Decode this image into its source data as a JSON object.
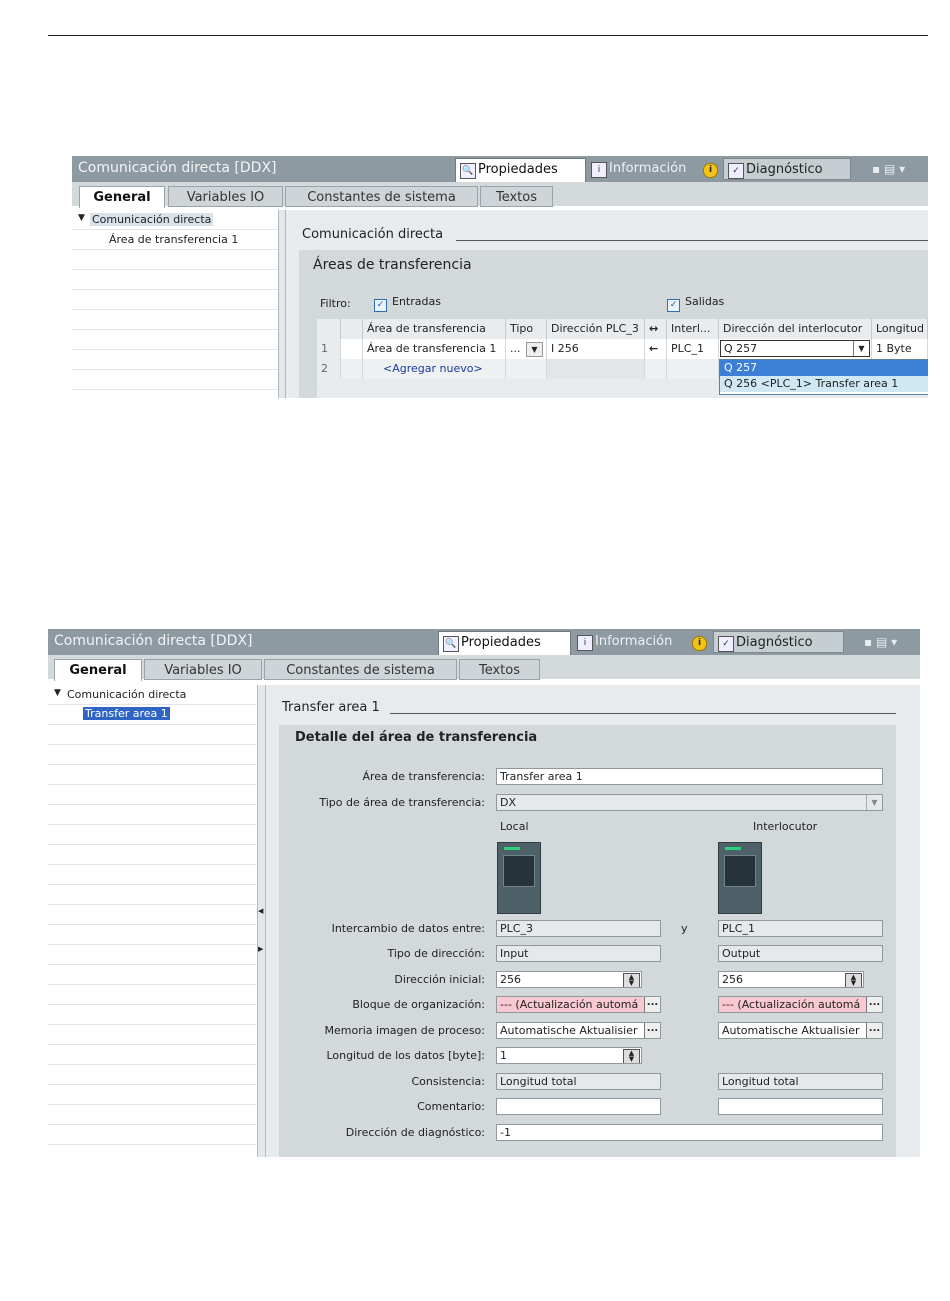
{
  "window": {
    "title": "Comunicación directa [DDX]",
    "inspector_tabs": [
      "Propiedades",
      "Información",
      "Diagnóstico"
    ],
    "main_tabs": [
      "General",
      "Variables IO",
      "Constantes de sistema",
      "Textos"
    ]
  },
  "panel1": {
    "tree_root": "Comunicación directa",
    "tree_child": "Área de transferencia 1",
    "section_title": "Comunicación directa",
    "group_title": "Áreas de transferencia",
    "filter_label": "Filtro:",
    "filter_inputs": "Entradas",
    "filter_outputs": "Salidas",
    "columns": [
      "Área de transferencia",
      "Tipo",
      "Dirección PLC_3",
      "↔",
      "Interl...",
      "Dirección del interlocutor",
      "Longitud"
    ],
    "rows": [
      {
        "num": "1",
        "area": "Área de transferencia 1",
        "tipo": "...",
        "dir_local": "I 256",
        "arrow": "←",
        "interl": "PLC_1",
        "dir_interl": "Q 257",
        "longitud": "1 Byte"
      },
      {
        "num": "2",
        "area": "<Agregar nuevo>",
        "tipo": "",
        "dir_local": "",
        "arrow": "",
        "interl": "",
        "dir_interl": "",
        "longitud": ""
      }
    ],
    "dropdown_options": [
      "Q 257",
      "Q 256 <PLC_1> Transfer area 1"
    ]
  },
  "panel2": {
    "tree_root": "Comunicación directa",
    "tree_child": "Transfer area 1",
    "section_title": "Transfer area 1",
    "group_title": "Detalle del área de transferencia",
    "labels": {
      "area": "Área de transferencia:",
      "tipo_area": "Tipo de área de transferencia:",
      "intercambio": "Intercambio de datos entre:",
      "tipo_dir": "Tipo de dirección:",
      "dir_inicial": "Dirección inicial:",
      "bloque": "Bloque de organización:",
      "memoria": "Memoria imagen de proceso:",
      "longitud": "Longitud de los datos [byte]:",
      "consistencia": "Consistencia:",
      "comentario": "Comentario:",
      "diagnostico": "Dirección de diagnóstico:"
    },
    "col_local": "Local",
    "col_interlocutor": "Interlocutor",
    "conj_y": "y",
    "values": {
      "area": "Transfer area 1",
      "tipo_area": "DX",
      "local_plc": "PLC_3",
      "remote_plc": "PLC_1",
      "local_tipo": "Input",
      "remote_tipo": "Output",
      "local_dir": "256",
      "remote_dir": "256",
      "local_bloque": "--- (Actualización automá",
      "remote_bloque": "--- (Actualización automá",
      "local_memoria": "Automatische Aktualisier",
      "remote_memoria": "Automatische Aktualisier",
      "longitud": "1",
      "local_consistencia": "Longitud total",
      "remote_consistencia": "Longitud total",
      "local_comentario": "",
      "remote_comentario": "",
      "diagnostico": "-1"
    }
  }
}
